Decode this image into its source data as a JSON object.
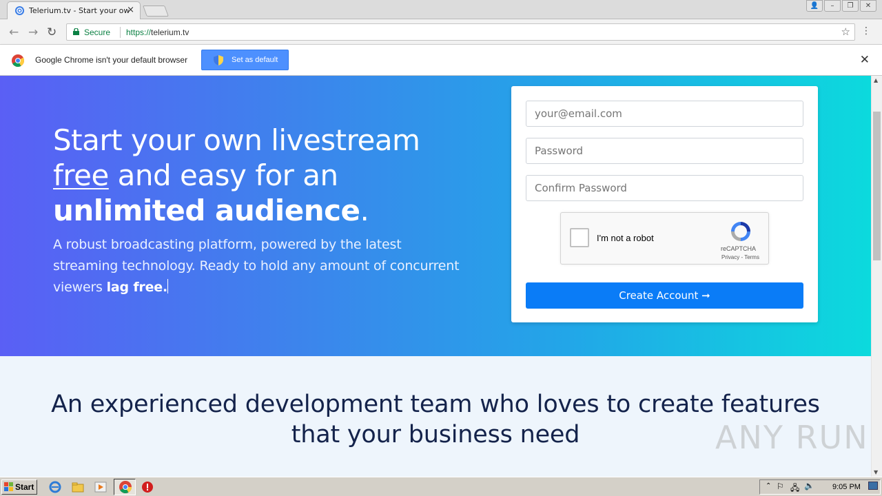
{
  "browser": {
    "tab_title": "Telerium.tv - Start your own",
    "tab_close": "×",
    "secure_label": "Secure",
    "url_scheme": "https://",
    "url_host": "telerium.tv",
    "star_glyph": "☆",
    "menu_glyph": "⋮",
    "back_glyph": "←",
    "forward_glyph": "→",
    "reload_glyph": "↻"
  },
  "infobar": {
    "message": "Google Chrome isn't your default browser",
    "button_label": "Set as default",
    "close_glyph": "✕"
  },
  "hero": {
    "line1": "Start your own livestream",
    "free_word": "free",
    "line2_rest": " and easy for an",
    "line3_bold": "unlimited audience",
    "line3_dot": ".",
    "sub_plain": "A robust broadcasting platform, powered by the latest streaming technology. Ready to hold any amount of concurrent viewers ",
    "sub_bold": "lag free."
  },
  "signup": {
    "email_placeholder": "your@email.com",
    "password_placeholder": "Password",
    "confirm_placeholder": "Confirm Password",
    "captcha_label": "I'm not a robot",
    "captcha_brand": "reCAPTCHA",
    "captcha_terms": "Privacy - Terms",
    "create_label": "Create Account ➞",
    "button_color": "#0a7cf7"
  },
  "section2": {
    "heading": "An experienced development team who loves to create features that your business need"
  },
  "watermark": "ANY RUN",
  "taskbar": {
    "start_label": "Start",
    "clock": "9:05 PM",
    "icons": [
      "ie-icon",
      "folder-icon",
      "media-player-icon",
      "chrome-icon",
      "stop-icon"
    ]
  },
  "colors": {
    "hero_gradient_start": "#5a5ff5",
    "hero_gradient_end": "#0cdadd",
    "section2_bg": "#eef5fc",
    "heading_color": "#14234b"
  }
}
